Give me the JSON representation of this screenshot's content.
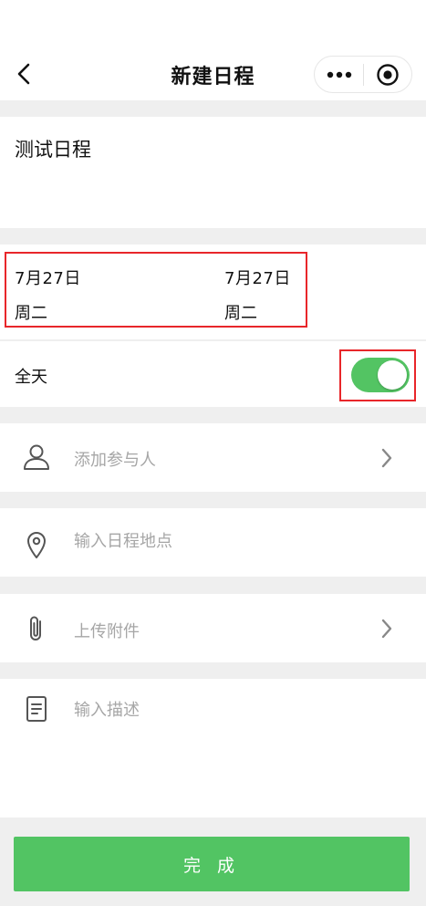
{
  "header": {
    "title": "新建日程",
    "back_icon": "chevron-left-icon",
    "more_icon": "more-dots-icon",
    "close_icon": "target-close-icon"
  },
  "title_field": {
    "value": "测试日程"
  },
  "dates": {
    "start": {
      "date": "7月27日",
      "weekday": "周二"
    },
    "end": {
      "date": "7月27日",
      "weekday": "周二"
    }
  },
  "all_day": {
    "label": "全天",
    "enabled": true,
    "on_color": "#53c463"
  },
  "rows": {
    "participants": {
      "placeholder": "添加参与人",
      "icon": "person-icon"
    },
    "location": {
      "placeholder": "输入日程地点",
      "icon": "location-pin-icon"
    },
    "attachment": {
      "placeholder": "上传附件",
      "icon": "paperclip-icon"
    },
    "description": {
      "placeholder": "输入描述",
      "icon": "document-icon"
    }
  },
  "footer": {
    "done_label": "完 成",
    "accent": "#52c463"
  }
}
